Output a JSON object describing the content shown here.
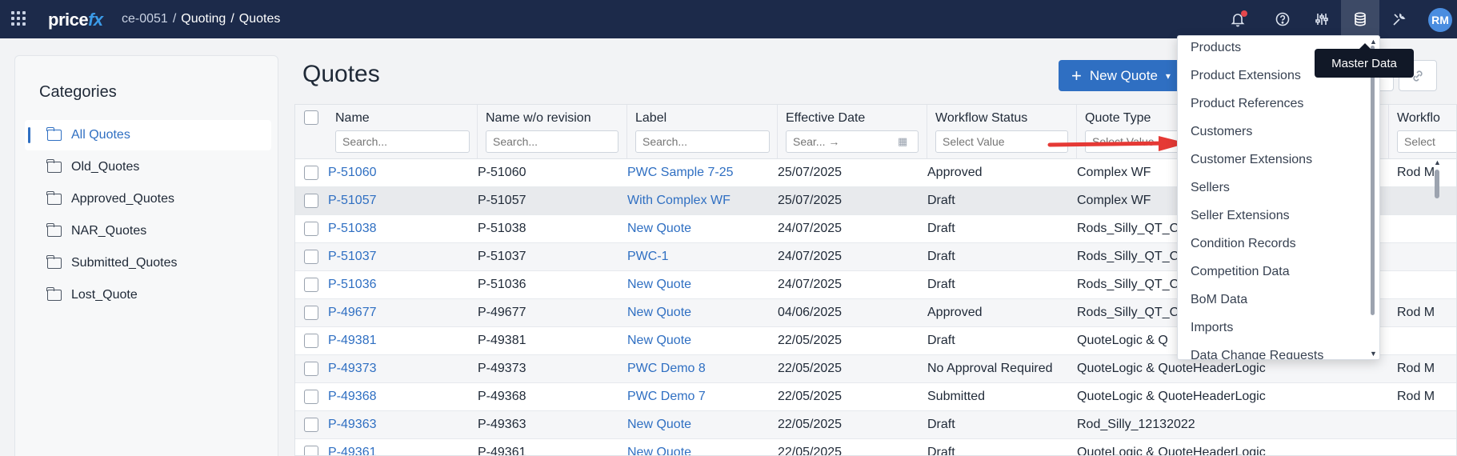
{
  "topbar": {
    "logo_main": "price",
    "logo_fx": "fx",
    "breadcrumb": [
      "ce-0051",
      "/",
      "Quoting",
      "/",
      "Quotes"
    ],
    "avatar_initials": "RM",
    "icons": [
      "apps-grid-icon",
      "bell-icon",
      "help-icon",
      "sliders-icon",
      "database-icon",
      "tools-icon"
    ]
  },
  "sidebar": {
    "title": "Categories",
    "items": [
      "All Quotes",
      "Old_Quotes",
      "Approved_Quotes",
      "NAR_Quotes",
      "Submitted_Quotes",
      "Lost_Quote"
    ],
    "active_index": 0
  },
  "main": {
    "title": "Quotes",
    "new_quote_label": "New Quote"
  },
  "grid": {
    "columns": [
      {
        "label": "Name",
        "placeholder": "Search..."
      },
      {
        "label": "Name w/o revision",
        "placeholder": "Search..."
      },
      {
        "label": "Label",
        "placeholder": "Search..."
      },
      {
        "label": "Effective Date",
        "placeholder": "Sear... →"
      },
      {
        "label": "Workflow Status",
        "placeholder": "Select Value"
      },
      {
        "label": "Quote Type",
        "placeholder": "Select Value"
      },
      {
        "label": "Workflo",
        "placeholder": "Select"
      }
    ],
    "rows": [
      [
        "P-51060",
        "P-51060",
        "PWC Sample 7-25",
        "25/07/2025",
        "Approved",
        "Complex WF",
        "Rod M"
      ],
      [
        "P-51057",
        "P-51057",
        "With Complex WF",
        "25/07/2025",
        "Draft",
        "Complex WF",
        ""
      ],
      [
        "P-51038",
        "P-51038",
        "New Quote",
        "24/07/2025",
        "Draft",
        "Rods_Silly_QT_C",
        ""
      ],
      [
        "P-51037",
        "P-51037",
        "PWC-1",
        "24/07/2025",
        "Draft",
        "Rods_Silly_QT_C",
        ""
      ],
      [
        "P-51036",
        "P-51036",
        "New Quote",
        "24/07/2025",
        "Draft",
        "Rods_Silly_QT_C",
        ""
      ],
      [
        "P-49677",
        "P-49677",
        "New Quote",
        "04/06/2025",
        "Approved",
        "Rods_Silly_QT_C",
        "Rod M"
      ],
      [
        "P-49381",
        "P-49381",
        "New Quote",
        "22/05/2025",
        "Draft",
        "QuoteLogic & Q",
        ""
      ],
      [
        "P-49373",
        "P-49373",
        "PWC Demo 8",
        "22/05/2025",
        "No Approval Required",
        "QuoteLogic & QuoteHeaderLogic",
        "Rod M"
      ],
      [
        "P-49368",
        "P-49368",
        "PWC Demo 7",
        "22/05/2025",
        "Submitted",
        "QuoteLogic & QuoteHeaderLogic",
        "Rod M"
      ],
      [
        "P-49363",
        "P-49363",
        "New Quote",
        "22/05/2025",
        "Draft",
        "Rod_Silly_12132022",
        ""
      ],
      [
        "P-49361",
        "P-49361",
        "New Quote",
        "22/05/2025",
        "Draft",
        "QuoteLogic & QuoteHeaderLogic",
        ""
      ]
    ]
  },
  "dropdown": {
    "items": [
      "Products",
      "Product Extensions",
      "Product References",
      "Customers",
      "Customer Extensions",
      "Sellers",
      "Seller Extensions",
      "Condition Records",
      "Competition Data",
      "BoM Data",
      "Imports",
      "Data Change Requests"
    ]
  },
  "tooltip": {
    "text": "Master Data"
  },
  "colors": {
    "topbar": "#1c2a4a",
    "accent": "#2f6fc2",
    "annotation_arrow": "#e53935"
  }
}
